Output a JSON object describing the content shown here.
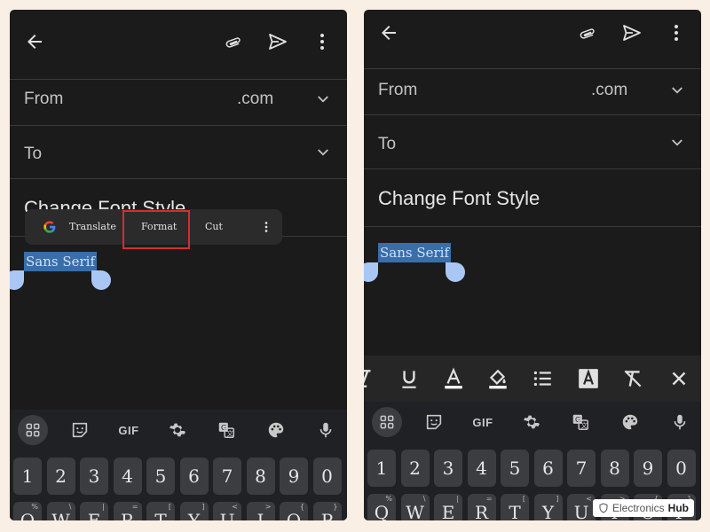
{
  "colors": {
    "background": "#f9efe4",
    "phone_bg": "#1b1b1b",
    "selection": "#3a6ea8",
    "handle": "#a9c7f5",
    "highlight": "#d32f2f"
  },
  "left": {
    "from_label": "From",
    "from_domain": ".com",
    "to_label": "To",
    "subject": "Change Font Style",
    "selected_text": "Sans Serif",
    "popup": {
      "translate": "Translate",
      "format": "Format",
      "cut": "Cut"
    }
  },
  "right": {
    "from_label": "From",
    "from_domain": ".com",
    "to_label": "To",
    "subject": "Change Font Style",
    "selected_text": "Sans Serif"
  },
  "keyboard": {
    "gif": "GIF",
    "numbers": [
      "1",
      "2",
      "3",
      "4",
      "5",
      "6",
      "7",
      "8",
      "9",
      "0"
    ],
    "letters": [
      "Q",
      "W",
      "E",
      "R",
      "T",
      "Y",
      "U",
      "I",
      "O",
      "P"
    ],
    "letter_subs": [
      "%",
      "\\",
      "|",
      "=",
      "[",
      "]",
      "<",
      ">",
      "{",
      "}"
    ]
  },
  "icons": [
    "back-arrow-icon",
    "attachment-icon",
    "send-icon",
    "more-vert-icon",
    "chevron-down-icon",
    "google-icon",
    "apps-grid-icon",
    "sticker-icon",
    "gear-icon",
    "translate-icon",
    "palette-icon",
    "mic-icon",
    "underline-icon",
    "text-color-icon",
    "fill-color-icon",
    "bullet-list-icon",
    "text-background-icon",
    "clear-format-icon",
    "close-icon"
  ],
  "watermark": {
    "brand1": "Electronics",
    "brand2": "Hub"
  }
}
